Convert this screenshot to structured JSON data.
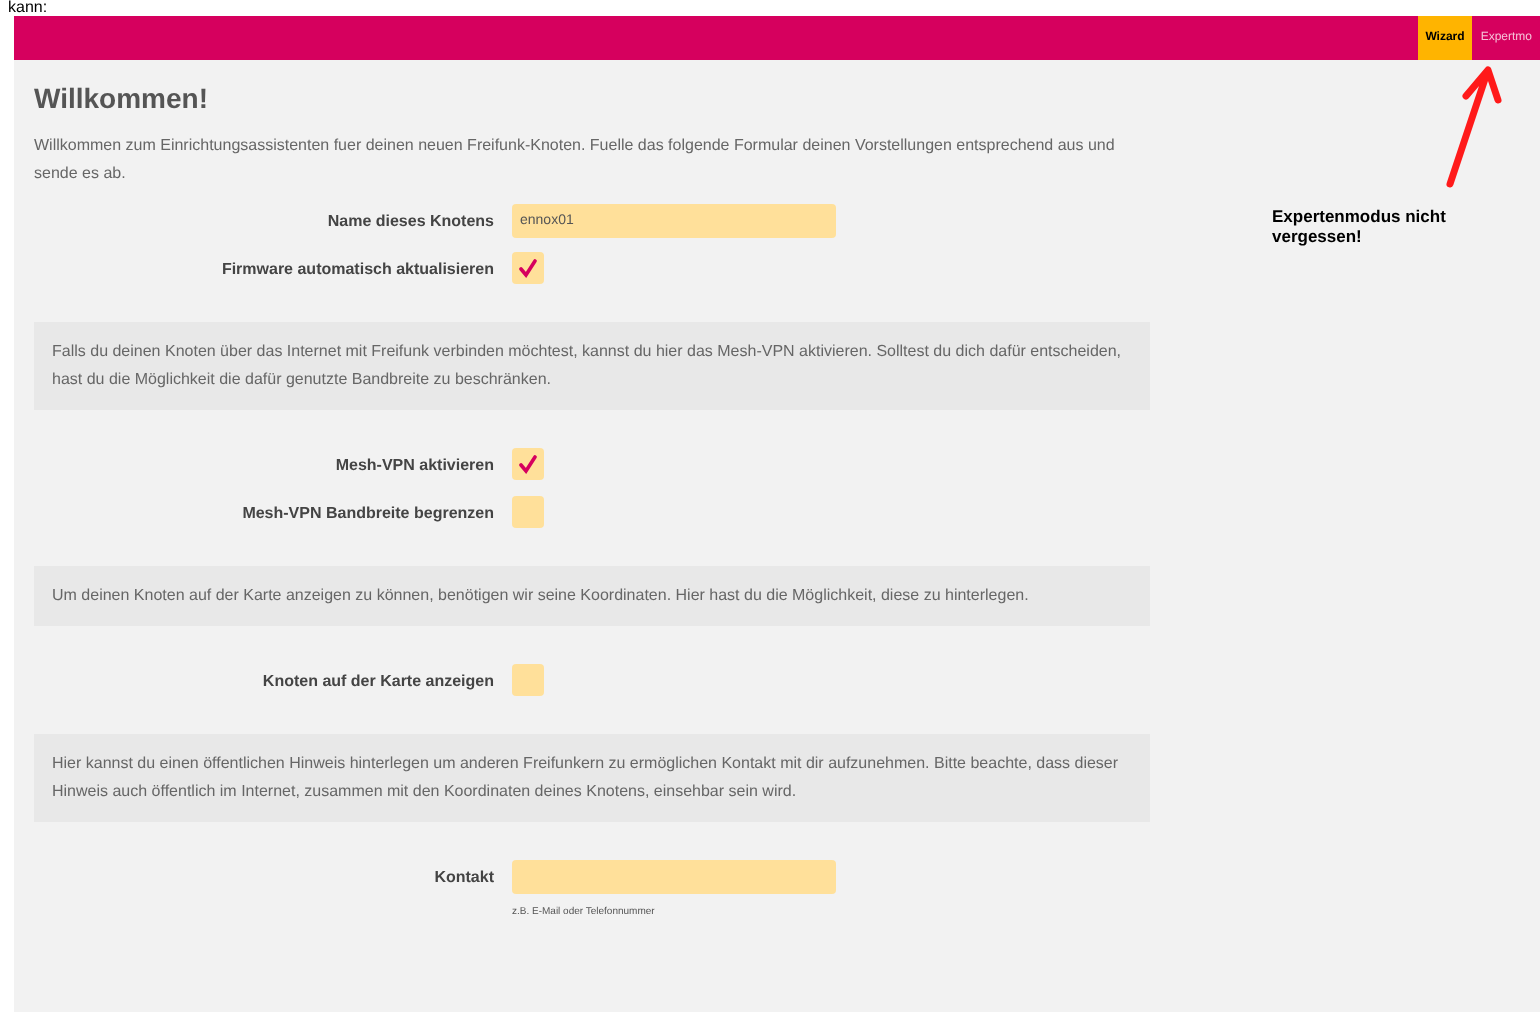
{
  "caption_fragment": "kann:",
  "navbar": {
    "tabs": [
      {
        "label": "Wizard",
        "selected": true
      },
      {
        "label": "Expertmo",
        "selected": false
      }
    ]
  },
  "title": "Willkommen!",
  "intro": "Willkommen zum Einrichtungsassistenten fuer deinen neuen Freifunk-Knoten. Fuelle das folgende Formular deinen Vorstellungen entsprechend aus und sende es ab.",
  "groups": [
    {
      "fields": [
        {
          "kind": "text",
          "label": "Name dieses Knotens",
          "value": "ennox01"
        },
        {
          "kind": "checkbox",
          "label": "Firmware automatisch aktualisieren",
          "checked": true
        }
      ]
    },
    {
      "info": "Falls du deinen Knoten über das Internet mit Freifunk verbinden möchtest, kannst du hier das Mesh-VPN aktivieren. Solltest du dich dafür entscheiden, hast du die Möglichkeit die dafür genutzte Bandbreite zu beschränken.",
      "fields": [
        {
          "kind": "checkbox",
          "label": "Mesh-VPN aktivieren",
          "checked": true
        },
        {
          "kind": "checkbox",
          "label": "Mesh-VPN Bandbreite begrenzen",
          "checked": false
        }
      ]
    },
    {
      "info": "Um deinen Knoten auf der Karte anzeigen zu können, benötigen wir seine Koordinaten. Hier hast du die Möglichkeit, diese zu hinterlegen.",
      "fields": [
        {
          "kind": "checkbox",
          "label": "Knoten auf der Karte anzeigen",
          "checked": false
        }
      ]
    },
    {
      "info": "Hier kannst du einen öffentlichen Hinweis hinterlegen um anderen Freifunkern zu ermöglichen Kontakt mit dir aufzunehmen. Bitte beachte, dass dieser Hinweis auch öffentlich im Internet, zusammen mit den Koordinaten deines Knotens, einsehbar sein wird.",
      "fields": [
        {
          "kind": "text",
          "label": "Kontakt",
          "hint": "z.B. E-Mail oder Telefonnummer"
        }
      ]
    }
  ],
  "annotation": "Expertenmodus nicht vergessen!"
}
